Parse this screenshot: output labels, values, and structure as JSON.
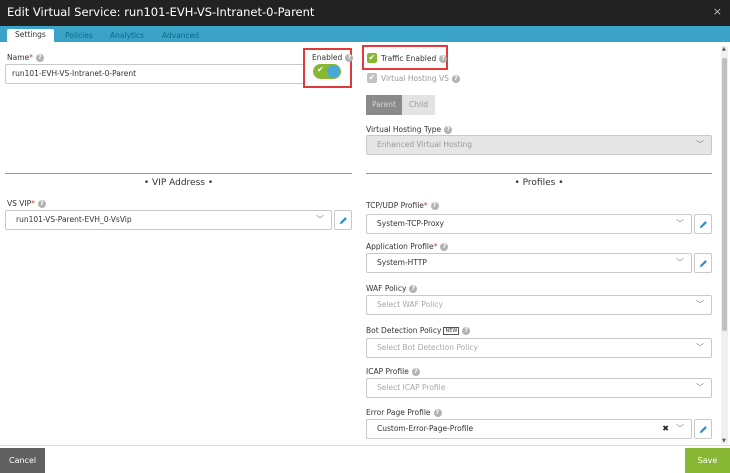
{
  "window": {
    "title": "Edit Virtual Service: run101-EVH-VS-Intranet-0-Parent",
    "close_glyph": "×"
  },
  "tabs": [
    {
      "label": "Settings",
      "active": true
    },
    {
      "label": "Policies"
    },
    {
      "label": "Analytics"
    },
    {
      "label": "Advanced"
    }
  ],
  "name_field": {
    "label": "Name",
    "required_mark": "*",
    "value": "run101-EVH-VS-Intranet-0-Parent"
  },
  "enabled": {
    "label": "Enabled",
    "on": true
  },
  "traffic_enabled": {
    "label": "Traffic Enabled",
    "checked": true
  },
  "virtual_hosting_vs": {
    "label": "Virtual Hosting VS",
    "checked": true,
    "disabled": true
  },
  "parent_child": {
    "parent_label": "Parent",
    "child_label": "Child",
    "selected": "Parent"
  },
  "virtual_hosting_type": {
    "label": "Virtual Hosting Type",
    "value": "Enhanced Virtual Hosting"
  },
  "vip_section": {
    "title": "• VIP Address •"
  },
  "vs_vip": {
    "label": "VS VIP",
    "required_mark": "*",
    "value": "run101-VS-Parent-EVH_0-VsVip"
  },
  "profiles_section": {
    "title": "• Profiles •"
  },
  "tcp_udp_profile": {
    "label": "TCP/UDP Profile",
    "required_mark": "*",
    "value": "System-TCP-Proxy"
  },
  "application_profile": {
    "label": "Application Profile",
    "required_mark": "*",
    "value": "System-HTTP"
  },
  "waf_policy": {
    "label": "WAF Policy",
    "placeholder": "Select WAF Policy"
  },
  "bot_detection_policy": {
    "label": "Bot Detection Policy",
    "badge": "NEW",
    "placeholder": "Select Bot Detection Policy"
  },
  "icap_profile": {
    "label": "ICAP Profile",
    "placeholder": "Select ICAP Profile"
  },
  "error_page_profile": {
    "label": "Error Page Profile",
    "value": "Custom-Error-Page-Profile"
  },
  "footer": {
    "cancel_label": "Cancel",
    "save_label": "Save"
  },
  "icons": {
    "help": "?",
    "chevron": "﹀",
    "clear": "✖",
    "check": "✔"
  },
  "colors": {
    "accent_green": "#88b734",
    "tab_blue": "#3aa3c7",
    "highlight_red": "#e13a3a",
    "title_bar": "#222222"
  }
}
